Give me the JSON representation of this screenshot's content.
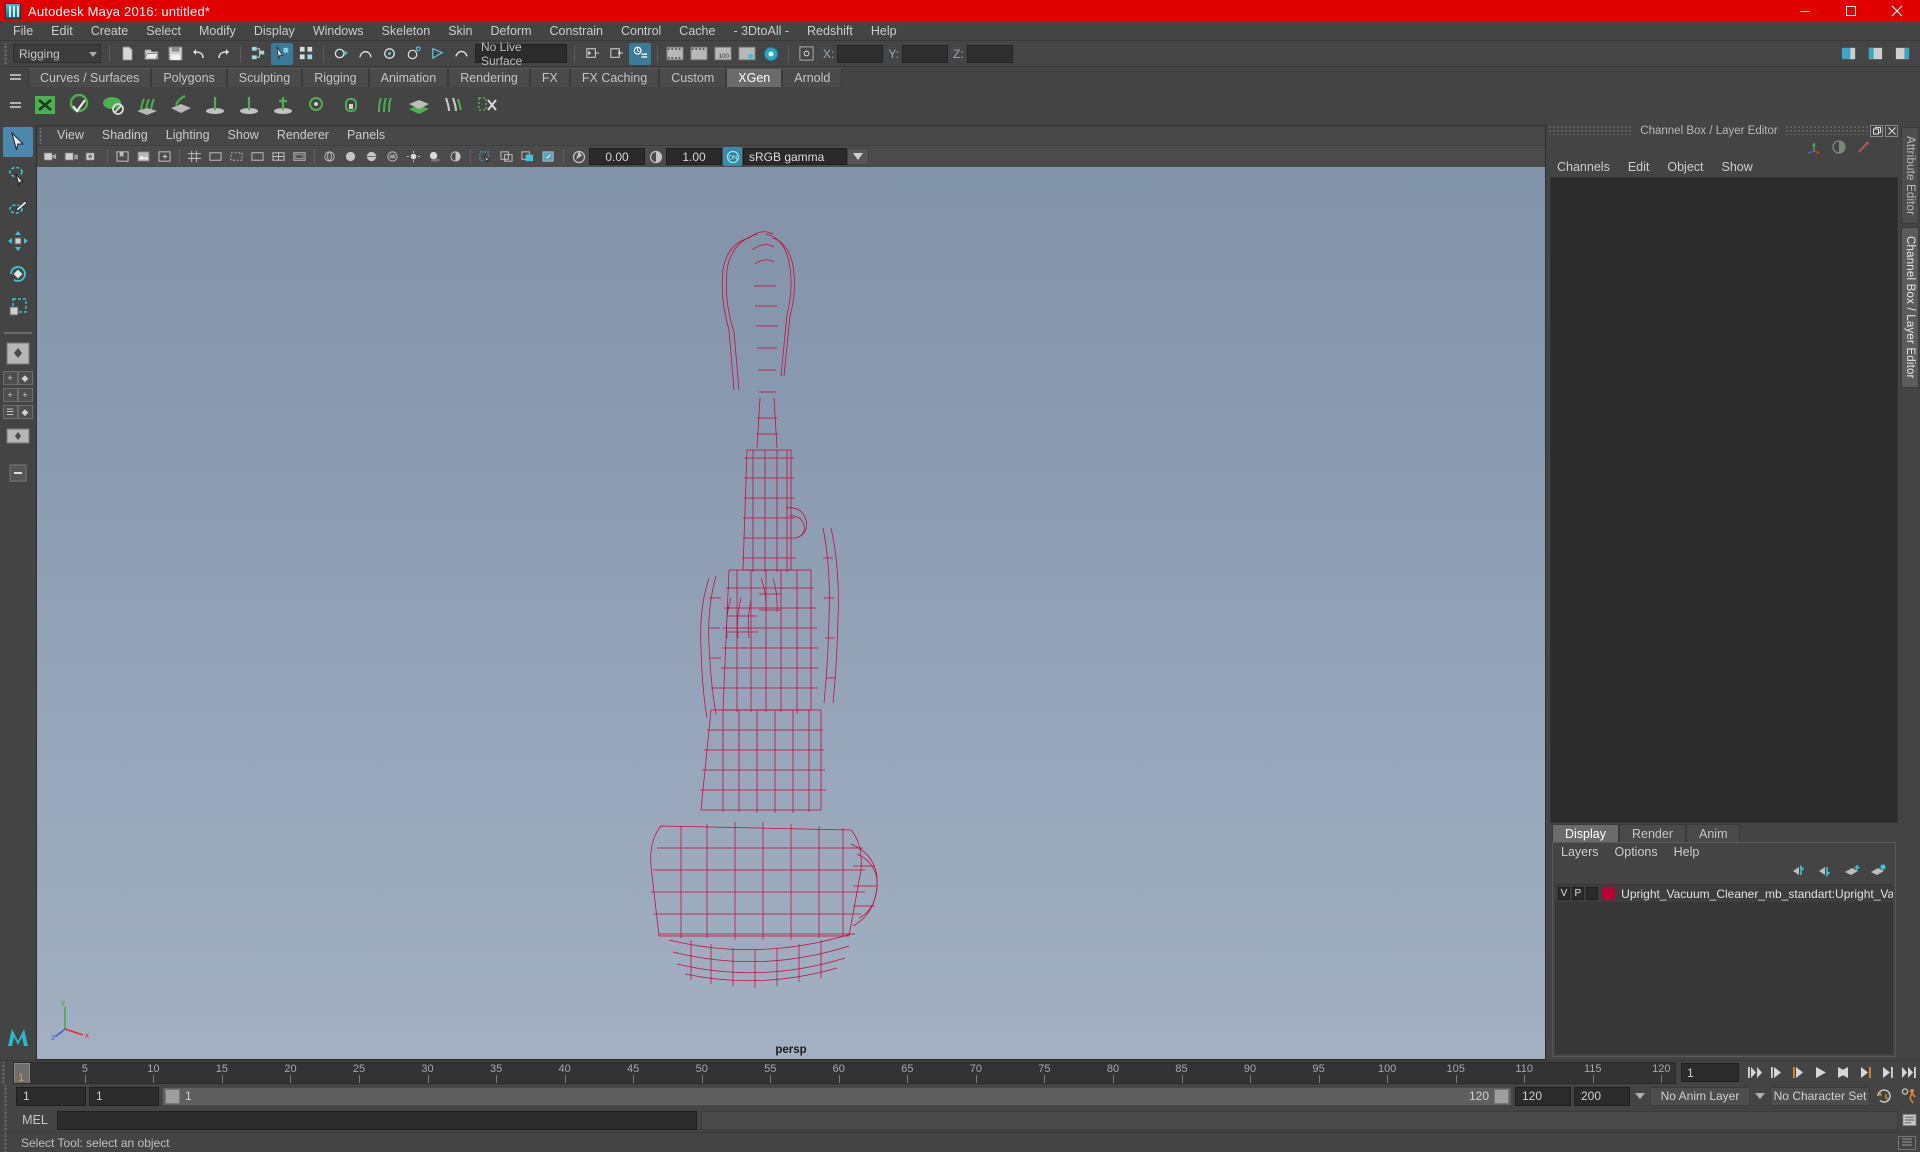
{
  "window": {
    "title": "Autodesk Maya 2016: untitled*",
    "logo_icon": "maya-logo-icon",
    "minimize_icon": "minimize-icon",
    "maximize_icon": "maximize-icon",
    "close_icon": "close-icon",
    "titlebar_color": "#e00000"
  },
  "menubar": {
    "items": [
      "File",
      "Edit",
      "Create",
      "Select",
      "Modify",
      "Display",
      "Windows",
      "Skeleton",
      "Skin",
      "Deform",
      "Constrain",
      "Control",
      "Cache",
      "- 3DtoAll -",
      "Redshift",
      "Help"
    ]
  },
  "statusline": {
    "menu_set": "Rigging",
    "live_surface": "No Live Surface",
    "coord_x_label": "X:",
    "coord_y_label": "Y:",
    "coord_z_label": "Z:",
    "coord_x_value": "",
    "coord_y_value": "",
    "coord_z_value": "",
    "icons": [
      "new-scene-icon",
      "open-scene-icon",
      "save-scene-icon",
      "undo-icon",
      "redo-icon",
      "select-by-hierarchy-icon",
      "select-by-object-icon",
      "select-by-component-icon",
      "snap-to-grid-icon",
      "snap-to-curve-icon",
      "snap-to-point-icon",
      "snap-to-projected-center-icon",
      "snap-to-view-plane-icon",
      "make-live-icon",
      "show-editor-icon",
      "show-outliner-icon",
      "show-attribute-editor-icon",
      "render-current-frame-icon",
      "ipr-render-icon",
      "render-settings-icon",
      "hypershade-icon",
      "render-view-icon",
      "selection-mask-icon"
    ]
  },
  "shelf": {
    "tabs": [
      "Curves / Surfaces",
      "Polygons",
      "Sculpting",
      "Rigging",
      "Animation",
      "Rendering",
      "FX",
      "FX Caching",
      "Custom",
      "XGen",
      "Arnold"
    ],
    "active_tab": "XGen",
    "burger_icon": "shelf-menu-icon",
    "icons": [
      "xgen-editor-icon",
      "xgen-preview-icon",
      "xgen-preview-off-icon",
      "xgen-add-guides-icon",
      "xgen-sculpt-guide-icon",
      "xgen-add-icon",
      "xgen-move-icon",
      "xgen-lock-icon",
      "xgen-comb-icon",
      "xgen-density-icon",
      "xgen-clump-icon",
      "xgen-region-icon",
      "xgen-noise-icon",
      "xgen-cut-icon"
    ]
  },
  "toolbox": {
    "items": [
      {
        "name": "select-tool",
        "selected": true
      },
      {
        "name": "lasso-select-tool",
        "selected": false
      },
      {
        "name": "paint-select-tool",
        "selected": false
      },
      {
        "name": "move-tool",
        "selected": false
      },
      {
        "name": "rotate-tool",
        "selected": false
      },
      {
        "name": "scale-tool",
        "selected": false
      }
    ],
    "layout_items": [
      "single-perspective-view-icon",
      "four-view-layout-icon",
      "outliner-persp-layout-icon",
      "persp-graph-layout-icon",
      "minimize-layout-icon"
    ]
  },
  "viewport": {
    "menus": [
      "View",
      "Shading",
      "Lighting",
      "Show",
      "Renderer",
      "Panels"
    ],
    "camera_label": "persp",
    "toolbar": {
      "exposure": "0.00",
      "gamma": "1.00",
      "color_space": "sRGB gamma",
      "color_mgmt_toggle": "ON",
      "icons": [
        "select-camera-icon",
        "lock-camera-icon",
        "camera-attributes-icon",
        "bookmarks-icon",
        "image-plane-icon",
        "two-d-pan-zoom-icon",
        "grid-toggle-icon",
        "film-gate-icon",
        "resolution-gate-icon",
        "gate-mask-icon",
        "field-chart-icon",
        "safe-action-icon",
        "safe-title-icon",
        "wireframe-icon",
        "smooth-shade-icon",
        "shaded-wireframe-icon",
        "textured-icon",
        "use-lights-icon",
        "shadows-icon",
        "ao-icon",
        "motion-blur-icon",
        "isolate-select-icon",
        "xray-icon",
        "xray-joints-icon",
        "exposure-icon",
        "gamma-icon",
        "color-management-icon"
      ]
    },
    "model_color": "#cc0033",
    "background_top": "#8293a9",
    "background_bottom": "#a3b0c2",
    "axis_gizmo": {
      "x_label": "x",
      "y_label": "y",
      "z_label": "z",
      "x_color": "#e03030",
      "y_color": "#3fae3f",
      "z_color": "#4060d0"
    }
  },
  "channel_box": {
    "dock_title": "Channel Box / Layer Editor",
    "undock_icon": "undock-icon",
    "close_icon": "panel-close-icon",
    "menus": [
      "Channels",
      "Edit",
      "Object",
      "Show"
    ],
    "header_icons": [
      "channel-box-icon",
      "attribute-editor-toggle-icon",
      "tool-settings-icon"
    ]
  },
  "right_tabs": {
    "items": [
      "Attribute Editor",
      "Channel Box / Layer Editor"
    ],
    "active": "Channel Box / Layer Editor"
  },
  "layer_editor": {
    "tabs": [
      "Display",
      "Render",
      "Anim"
    ],
    "active_tab": "Display",
    "menus": [
      "Layers",
      "Options",
      "Help"
    ],
    "buttons": [
      "move-layer-up-icon",
      "move-layer-down-icon",
      "new-layer-icon",
      "new-layer-from-selected-icon"
    ],
    "layers": [
      {
        "visibility": "V",
        "playback": "P",
        "state": "",
        "color": "#bb0033",
        "name": "Upright_Vacuum_Cleaner_mb_standart:Upright_Vacuum"
      }
    ]
  },
  "time_slider": {
    "current_frame": "1",
    "start": 1,
    "end": 120,
    "tick_step": 5,
    "tick_labels": [
      5,
      10,
      15,
      20,
      25,
      30,
      35,
      40,
      45,
      50,
      55,
      60,
      65,
      70,
      75,
      80,
      85,
      90,
      95,
      100,
      105,
      110,
      115,
      120
    ],
    "current_field": "1",
    "playback_buttons": [
      "go-to-start-icon",
      "step-back-keyframe-icon",
      "step-back-frame-icon",
      "play-backwards-icon",
      "play-forwards-icon",
      "step-forward-frame-icon",
      "step-forward-keyframe-icon",
      "go-to-end-icon"
    ]
  },
  "range_slider": {
    "anim_start": "1",
    "range_start": "1",
    "bar_left_label": "1",
    "bar_right_label": "120",
    "range_end": "120",
    "anim_end": "200",
    "anim_layer": "No Anim Layer",
    "character_set": "No Character Set",
    "auto_key_icon": "auto-keyframe-icon",
    "anim_prefs_icon": "animation-preferences-icon"
  },
  "command_line": {
    "language_label": "MEL",
    "input_value": "",
    "input_placeholder": "",
    "script_editor_icon": "script-editor-icon"
  },
  "status_bar": {
    "help_text": "Select Tool: select an object",
    "right_icon": "resize-grip-icon"
  }
}
